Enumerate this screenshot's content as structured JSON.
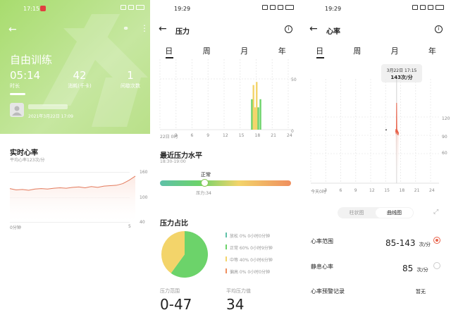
{
  "workout": {
    "status_time": "17:15",
    "title": "自由训练",
    "stats": [
      {
        "value": "05:14",
        "label": "时长"
      },
      {
        "value": "42",
        "label": "消耗(千卡)"
      },
      {
        "value": "1",
        "label": "间歇次数"
      }
    ],
    "date": "2021年3月22日 17:09",
    "hr_title": "实时心率",
    "hr_subtitle": "平均心率123次/分",
    "y_ticks": [
      "160",
      "100",
      "40"
    ],
    "x_start": "0分钟",
    "x_end": "5",
    "colors": {
      "header": "#b5e07e",
      "line": "#e37a5c",
      "fill": "#fce9e3"
    }
  },
  "stress": {
    "status_time": "19:29",
    "title": "压力",
    "tabs": [
      "日",
      "周",
      "月",
      "年"
    ],
    "x_ticks": [
      "22日 0时",
      "3",
      "6",
      "9",
      "12",
      "15",
      "18",
      "21",
      "24"
    ],
    "y_ticks": [
      "50",
      "0"
    ],
    "recent_title": "最近压力水平",
    "recent_time": "18:30-19:00",
    "level_label": "正常",
    "level_value": "压力:34",
    "level_fraction": 0.34,
    "ratio_title": "压力占比",
    "legend": [
      {
        "label": "放松",
        "percent": "0%",
        "duration": "0小时0分钟",
        "color": "#5ec0a8"
      },
      {
        "label": "正常",
        "percent": "60%",
        "duration": "0小时9分钟",
        "color": "#6cd36a"
      },
      {
        "label": "中等",
        "percent": "40%",
        "duration": "0小时6分钟",
        "color": "#f3d46a"
      },
      {
        "label": "偏高",
        "percent": "0%",
        "duration": "0小时0分钟",
        "color": "#ef8f5f"
      }
    ],
    "range_label": "压力范围",
    "range_value": "0-47",
    "avg_label": "平均压力值",
    "avg_value": "34"
  },
  "heart": {
    "status_time": "19:29",
    "title": "心率",
    "tabs": [
      "日",
      "周",
      "月",
      "年"
    ],
    "tooltip_date": "3月22日 17:15",
    "tooltip_value": "143次/分",
    "y_ticks": [
      "120",
      "90",
      "60"
    ],
    "x_ticks": [
      "今天0时",
      "3",
      "6",
      "9",
      "12",
      "15",
      "18",
      "21",
      "24"
    ],
    "toggle": [
      "柱状图",
      "曲线图"
    ],
    "range_label": "心率范围",
    "range_value": "85-143",
    "range_unit": "次/分",
    "resting_label": "静息心率",
    "resting_value": "85",
    "resting_unit": "次/分",
    "alert_label": "心率预警记录",
    "alert_value": "暂无",
    "colors": {
      "accent": "#e8624a"
    }
  },
  "chart_data": [
    {
      "type": "area",
      "title": "实时心率",
      "xlabel": "",
      "ylabel": "",
      "ylim": [
        40,
        160
      ],
      "x": [
        0,
        0.25,
        0.5,
        0.75,
        1,
        1.25,
        1.5,
        1.75,
        2,
        2.25,
        2.5,
        2.75,
        3,
        3.25,
        3.5,
        3.75,
        4,
        4.25,
        4.5,
        4.75,
        5
      ],
      "values": [
        120,
        117,
        118,
        116,
        119,
        120,
        119,
        121,
        122,
        121,
        123,
        124,
        122,
        125,
        123,
        126,
        127,
        128,
        132,
        140,
        150
      ]
    },
    {
      "type": "bar",
      "title": "压力",
      "xlabel": "",
      "ylabel": "",
      "ylim": [
        0,
        50
      ],
      "x": [
        17.2,
        17.5,
        17.8,
        18.1,
        18.4,
        18.8
      ],
      "values": [
        30,
        44,
        22,
        47,
        22,
        30
      ]
    },
    {
      "type": "pie",
      "title": "压力占比",
      "categories": [
        "放松",
        "正常",
        "中等",
        "偏高"
      ],
      "values": [
        0,
        60,
        40,
        0
      ]
    },
    {
      "type": "line",
      "title": "心率",
      "xlabel": "",
      "ylabel": "",
      "ylim": [
        40,
        150
      ],
      "x": [
        15.1,
        17.0,
        17.05,
        17.1,
        17.15,
        17.2,
        17.25,
        17.3,
        17.35,
        17.4,
        17.45,
        17.5,
        17.55,
        17.6
      ],
      "values": [
        99,
        95,
        100,
        92,
        96,
        143,
        100,
        94,
        99,
        91,
        97,
        90,
        95,
        93
      ]
    }
  ]
}
